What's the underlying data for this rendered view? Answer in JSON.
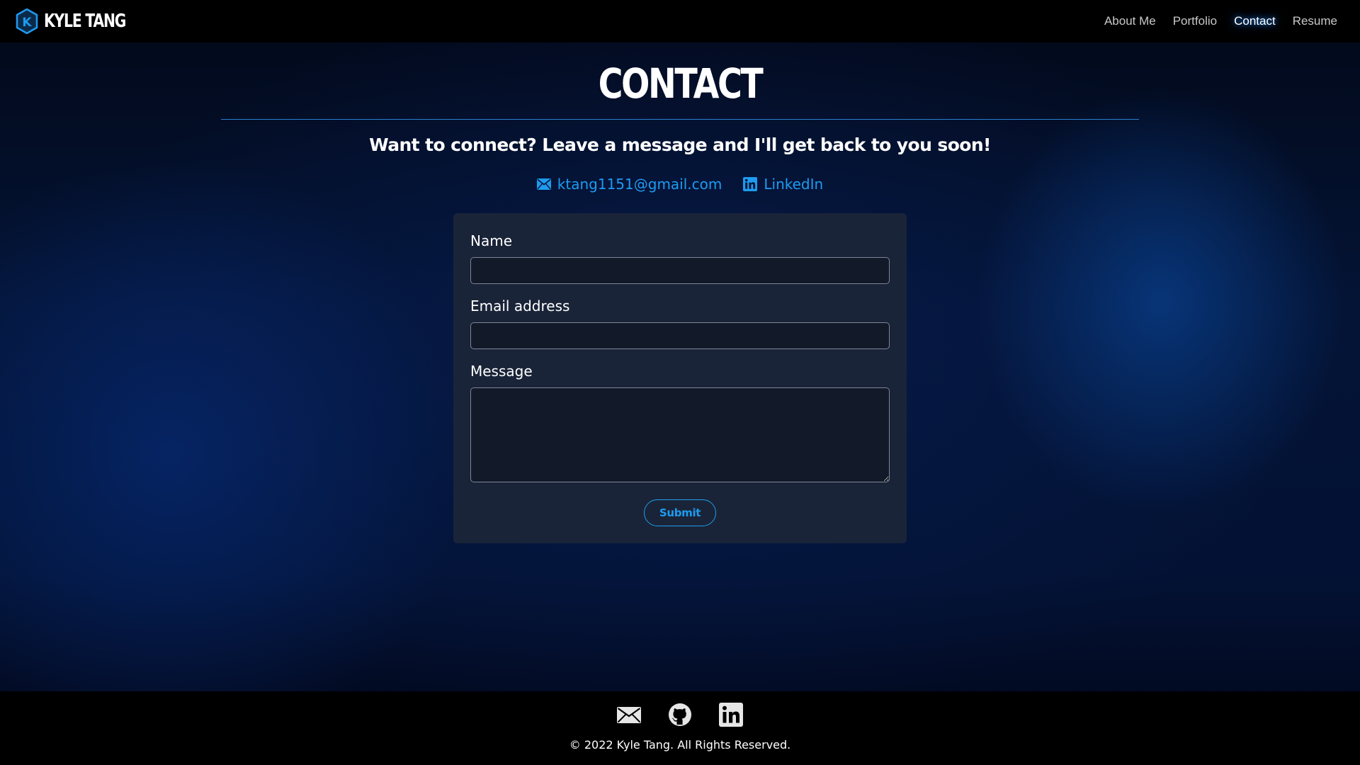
{
  "colors": {
    "accent": "#1e9bf0",
    "navbar_bg": "#000000",
    "card_bg": "#1a2438",
    "input_bg": "#121a2a"
  },
  "navbar": {
    "brand_initial": "K",
    "brand_name": "KYLE TANG",
    "links": [
      {
        "label": "About Me",
        "active": false
      },
      {
        "label": "Portfolio",
        "active": false
      },
      {
        "label": "Contact",
        "active": true
      },
      {
        "label": "Resume",
        "active": false
      }
    ]
  },
  "main": {
    "title": "CONTACT",
    "subtitle": "Want to connect? Leave a message and I'll get back to you soon!",
    "contact_links": [
      {
        "icon": "envelope-icon",
        "label": "ktang1151@gmail.com"
      },
      {
        "icon": "linkedin-icon",
        "label": "LinkedIn"
      }
    ]
  },
  "form": {
    "name_label": "Name",
    "name_value": "",
    "email_label": "Email address",
    "email_value": "",
    "message_label": "Message",
    "message_value": "",
    "submit_label": "Submit"
  },
  "footer": {
    "icons": [
      "envelope-icon",
      "github-icon",
      "linkedin-icon"
    ],
    "copyright": "© 2022 Kyle Tang. All Rights Reserved."
  }
}
